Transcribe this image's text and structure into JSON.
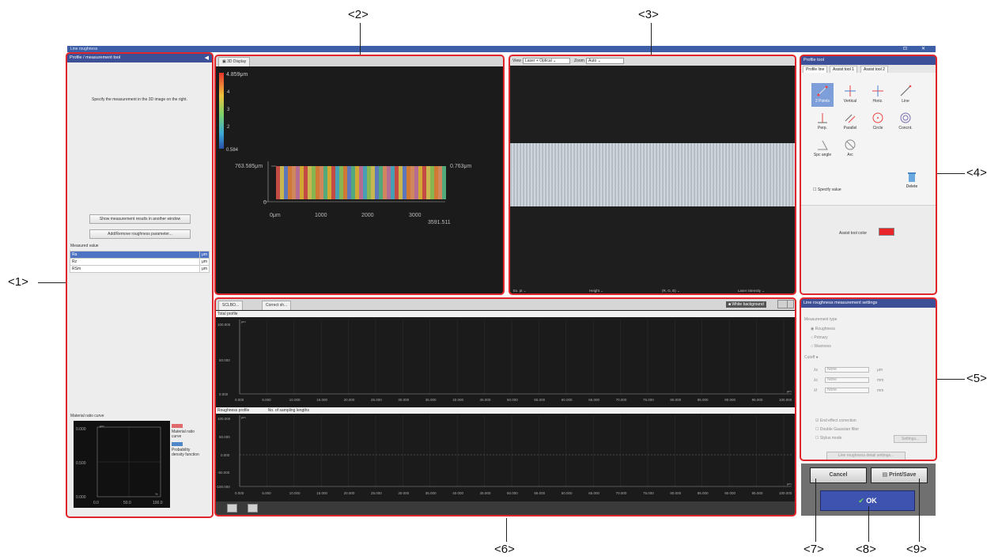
{
  "callouts": {
    "c1": "<1>",
    "c2": "<2>",
    "c3": "<3>",
    "c4": "<4>",
    "c5": "<5>",
    "c6": "<6>",
    "c7": "<7>",
    "c8": "<8>",
    "c9": "<9>"
  },
  "window": {
    "title": "Line roughness",
    "controls": [
      "⊡",
      "✕"
    ]
  },
  "panel1": {
    "header": "Profile / measurement tool",
    "instruction": "Specify the measurement in the 3D image on the right.",
    "btn_show": "Show measurement results in another window",
    "btn_addremove": "Add/Remove roughness parameter...",
    "measured_label": "Measured value",
    "rows": [
      {
        "name": "Ra",
        "unit": "μm"
      },
      {
        "name": "Rz",
        "unit": "μm"
      },
      {
        "name": "RSm",
        "unit": "μm"
      }
    ],
    "mrc_label": "Material ratio curve",
    "mrc_yticks": [
      "0.000",
      "0.500",
      "0.000"
    ],
    "mrc_xticks": [
      "0.0",
      "50.0",
      "100.0"
    ],
    "mrc_units": {
      "y": "μm",
      "x": "%"
    },
    "legend": [
      {
        "label": "Material ratio curve",
        "color": "#e0696b"
      },
      {
        "label": "Probability density function",
        "color": "#4f87c9"
      }
    ]
  },
  "panel2": {
    "tab": "3D Display",
    "scale_max": "4.859μm",
    "scale_ticks": [
      "4",
      "3",
      "2"
    ],
    "scale_min": "0.584",
    "y_left": "763.585μm",
    "y_right": "0.763μm",
    "y_zero": "0",
    "x_ticks": [
      "0μm",
      "1000",
      "2000",
      "3000"
    ],
    "x_end": "3591.511"
  },
  "panel3": {
    "view_label": "View",
    "view_value": "Laser + Optical",
    "zoom_label": "Zoom",
    "zoom_value": "Auto",
    "bottom": [
      "Ex. pt  ⌄",
      "Height  ⌄",
      "(R, G, B)  ⌄",
      "Laser intensity  ⌄"
    ]
  },
  "panel4": {
    "header": "Profile tool",
    "subtabs": [
      "Profile line",
      "Assist tool 1",
      "Assist tool 2"
    ],
    "tools": [
      {
        "label": "2 Points",
        "icon": "two-points-icon",
        "active": true
      },
      {
        "label": "Vertical",
        "icon": "vertical-icon",
        "active": false
      },
      {
        "label": "Horiz.",
        "icon": "horizontal-icon",
        "active": false
      },
      {
        "label": "Line",
        "icon": "line-icon",
        "active": false
      },
      {
        "label": "Perp.",
        "icon": "perpendicular-icon",
        "active": false
      },
      {
        "label": "Parallel",
        "icon": "parallel-icon",
        "active": false
      },
      {
        "label": "Circle",
        "icon": "circle-icon",
        "active": false
      },
      {
        "label": "Concnt.",
        "icon": "concentric-icon",
        "active": false
      },
      {
        "label": "Spc angle",
        "icon": "angle-icon",
        "active": false
      },
      {
        "label": "Arc",
        "icon": "arc-icon",
        "active": false
      }
    ],
    "specify": "Specify value",
    "delete": "Delete",
    "assist_color_label": "Assist tool color",
    "assist_color": "#e8262a"
  },
  "panel5": {
    "header": "Line roughness measurement settings",
    "measure_type_label": "Measurement type",
    "types": [
      "Roughness",
      "Primary",
      "Waviness"
    ],
    "cutoff_label": "Cutoff",
    "cutoff_rows": [
      {
        "name": "λs",
        "value": "None",
        "unit": "μm"
      },
      {
        "name": "λc",
        "value": "None",
        "unit": "mm"
      },
      {
        "name": "λf",
        "value": "None",
        "unit": "mm"
      }
    ],
    "checks": [
      "End effect correction",
      "Double Gaussian filter",
      "Stylus mode"
    ],
    "settings_btn": "Settings...",
    "apply_btn": "Line roughness detail settings..."
  },
  "panel6": {
    "tabs": [
      "SCLBO...",
      "Correct sh..."
    ],
    "white_bg": "White background",
    "graph1_title": "Total profile",
    "graph1_unit": "μm",
    "graph1_yticks": [
      "100.000",
      "50.000",
      "0.000"
    ],
    "graph2_title": "Roughness profile",
    "graph2_sub": "No. of sampling lengths",
    "graph2_unit": "μm",
    "graph2_yticks": [
      "100.000",
      "50.000",
      "0.000",
      "-50.000",
      "-100.000"
    ],
    "xticks": [
      "0.000",
      "5.000",
      "10.000",
      "15.000",
      "20.000",
      "25.000",
      "30.000",
      "35.000",
      "40.000",
      "45.000",
      "50.000",
      "55.000",
      "60.000",
      "65.000",
      "70.000",
      "75.000",
      "80.000",
      "85.000",
      "90.000",
      "95.000",
      "100.000"
    ],
    "x_unit": "μm"
  },
  "buttons": {
    "cancel": "Cancel",
    "print_save": "Print/Save",
    "ok": "OK"
  }
}
